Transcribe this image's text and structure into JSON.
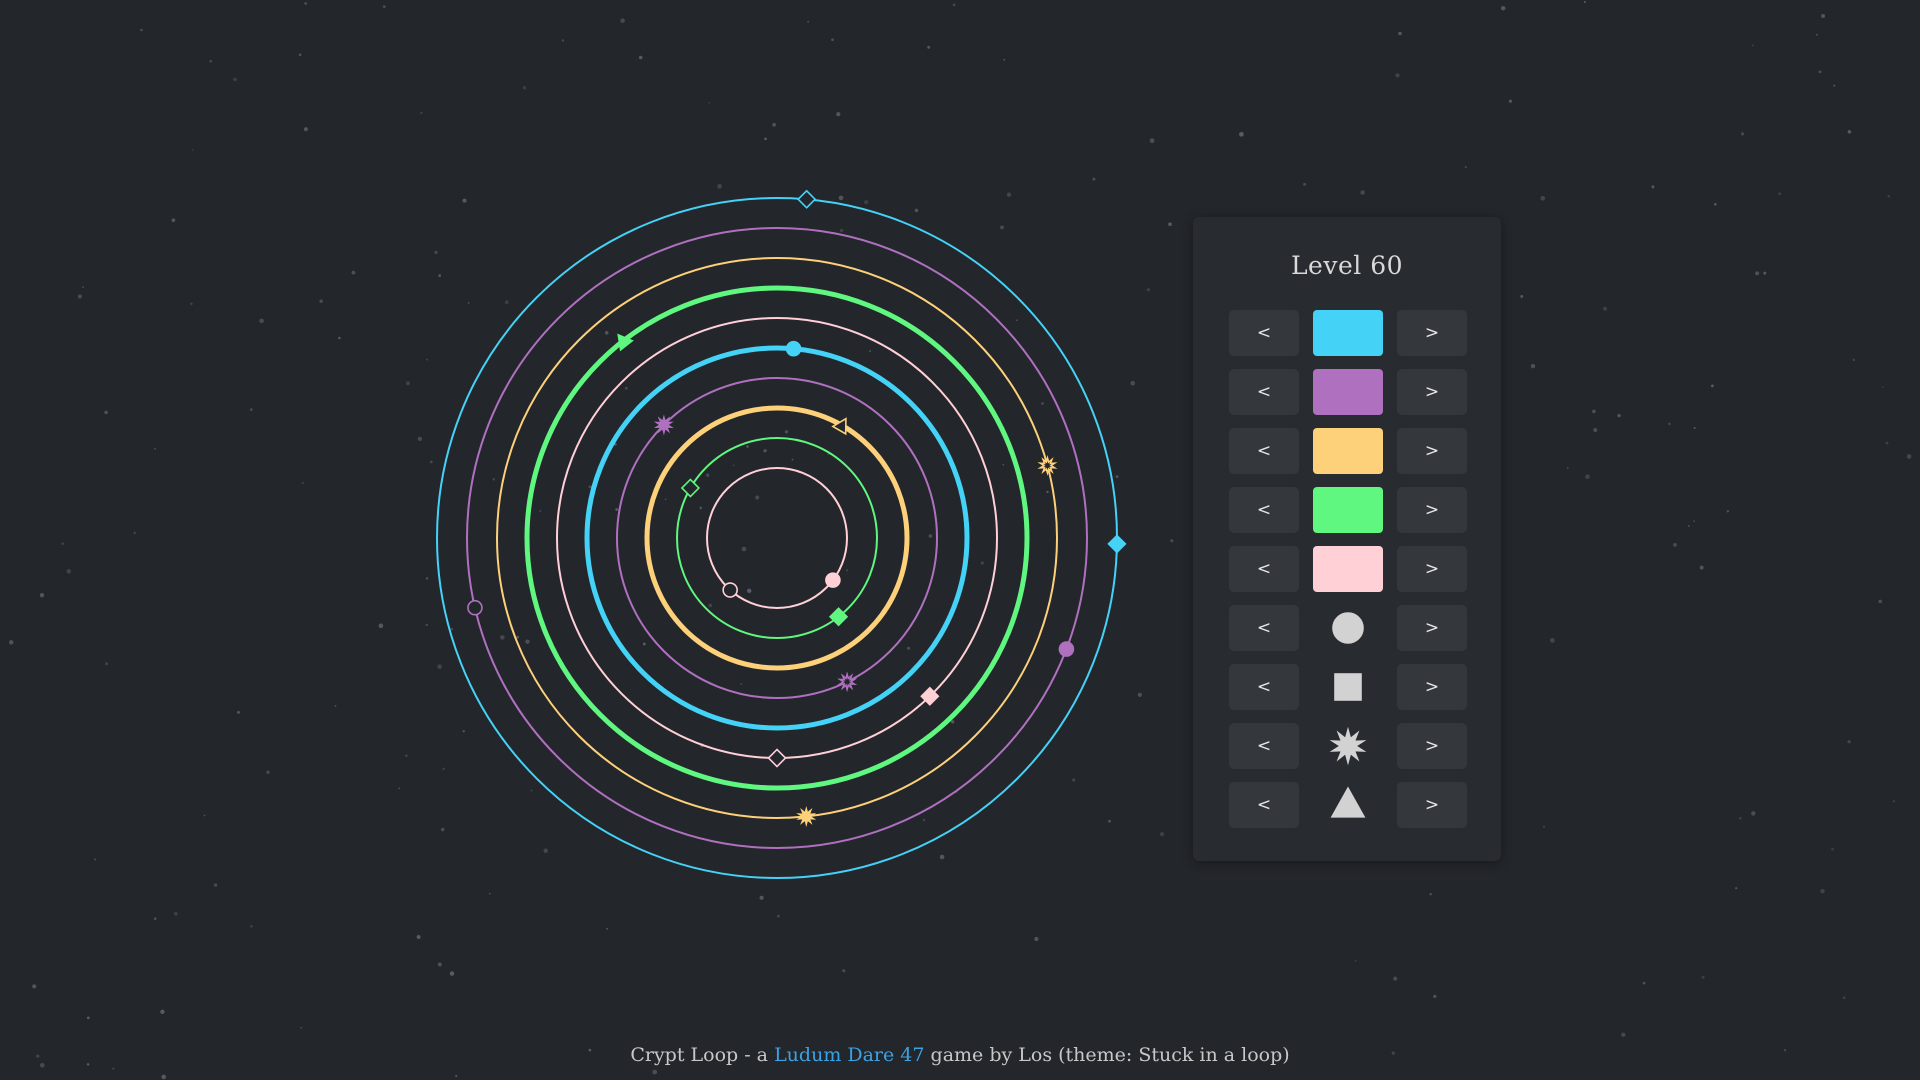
{
  "game": {
    "title": "Crypt Loop",
    "footer_prefix": "Crypt Loop - a",
    "footer_link": "Ludum Dare 47",
    "footer_suffix": "game by Los (theme: Stuck in a loop)"
  },
  "panel": {
    "title": "Level 60",
    "prev_label": "<",
    "next_label": ">",
    "color_selectors": [
      {
        "color": "#44d2f7"
      },
      {
        "color": "#b070c0"
      },
      {
        "color": "#fdd07a"
      },
      {
        "color": "#5ff77f"
      },
      {
        "color": "#ffd0d6"
      }
    ],
    "shape_selectors": [
      {
        "shape": "circle"
      },
      {
        "shape": "square"
      },
      {
        "shape": "starburst"
      },
      {
        "shape": "triangle"
      }
    ],
    "shape_fill": "#d2d2d2"
  },
  "board": {
    "rings": [
      {
        "color": "#ffd0d6",
        "thick": false
      },
      {
        "color": "#5ff77f",
        "thick": false
      },
      {
        "color": "#fdd07a",
        "thick": true
      },
      {
        "color": "#b070c0",
        "thick": false
      },
      {
        "color": "#44d2f7",
        "thick": true
      },
      {
        "color": "#ffd0d6",
        "thick": false
      },
      {
        "color": "#5ff77f",
        "thick": true
      },
      {
        "color": "#fdd07a",
        "thick": false
      },
      {
        "color": "#b070c0",
        "thick": false
      },
      {
        "color": "#44d2f7",
        "thick": false
      }
    ],
    "pieces": [
      {
        "ring": 0,
        "angle": 132,
        "shape": "circle",
        "color": "#ffd0d6",
        "filled": false
      },
      {
        "ring": 0,
        "angle": 37,
        "shape": "circle",
        "color": "#ffd0d6",
        "filled": true
      },
      {
        "ring": 1,
        "angle": 210,
        "shape": "square",
        "color": "#5ff77f",
        "filled": false
      },
      {
        "ring": 1,
        "angle": 52,
        "shape": "square",
        "color": "#5ff77f",
        "filled": true
      },
      {
        "ring": 2,
        "angle": 300,
        "shape": "triangle",
        "color": "#fdd07a",
        "filled": false
      },
      {
        "ring": 3,
        "angle": 225,
        "shape": "starburst",
        "color": "#b070c0",
        "filled": true
      },
      {
        "ring": 3,
        "angle": 64,
        "shape": "starburst",
        "color": "#b070c0",
        "filled": false
      },
      {
        "ring": 4,
        "angle": 275,
        "shape": "circle",
        "color": "#44d2f7",
        "filled": true
      },
      {
        "ring": 5,
        "angle": 90,
        "shape": "square",
        "color": "#ffd0d6",
        "filled": false
      },
      {
        "ring": 5,
        "angle": 46,
        "shape": "square",
        "color": "#ffd0d6",
        "filled": true
      },
      {
        "ring": 6,
        "angle": 232,
        "shape": "triangle",
        "color": "#5ff77f",
        "filled": true
      },
      {
        "ring": 7,
        "angle": 84,
        "shape": "starburst",
        "color": "#fdd07a",
        "filled": true
      },
      {
        "ring": 7,
        "angle": 345,
        "shape": "starburst",
        "color": "#fdd07a",
        "filled": false
      },
      {
        "ring": 8,
        "angle": 167,
        "shape": "circle",
        "color": "#b070c0",
        "filled": false
      },
      {
        "ring": 8,
        "angle": 21,
        "shape": "circle",
        "color": "#b070c0",
        "filled": true
      },
      {
        "ring": 9,
        "angle": 275,
        "shape": "square",
        "color": "#44d2f7",
        "filled": false
      },
      {
        "ring": 9,
        "angle": 1,
        "shape": "square",
        "color": "#44d2f7",
        "filled": true
      }
    ]
  },
  "theme": {
    "background": "#23262b",
    "panel_bg": "#282b30",
    "button_bg": "#34373c",
    "link_color": "#3aa3e6",
    "star_color": "#5a5d63"
  }
}
